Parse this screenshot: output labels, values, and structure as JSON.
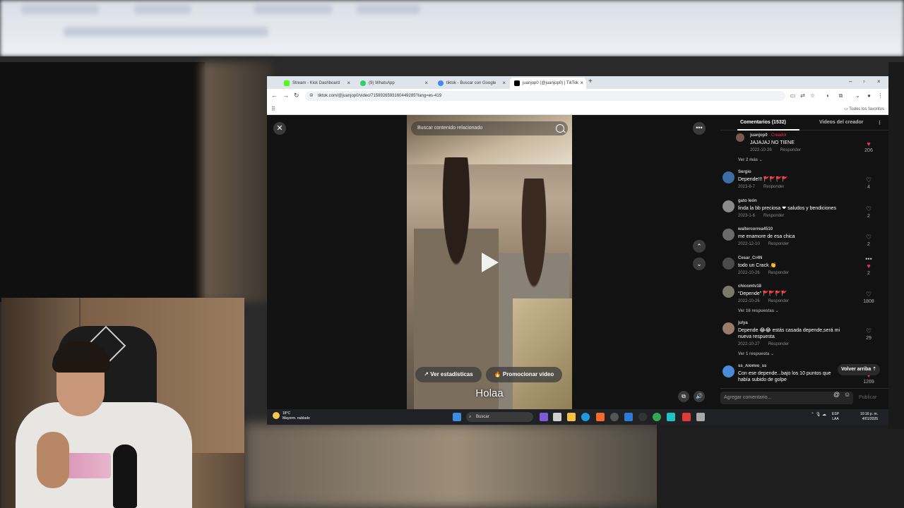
{
  "browser": {
    "tabs": [
      {
        "title": "Stream - Kick Dashboard",
        "color": "#53fc18"
      },
      {
        "title": "(9) WhatsApp",
        "color": "#25d366"
      },
      {
        "title": "tiktok - Buscar con Google",
        "color": "#4285f4"
      },
      {
        "title": "juanjop0 (@juanjop0) | TikTok",
        "color": "#000000"
      }
    ],
    "url": "tiktok.com/@juanjop0/video/7158926593160449285?lang=es-419",
    "bookmarks_label": "Todos los favoritos"
  },
  "video": {
    "search_placeholder": "Buscar contenido relacionado",
    "stats_button": "Ver estadísticas",
    "promote_button": "Promocionar video",
    "caption": "Holaa"
  },
  "comments": {
    "tab_comments": "Comentarios (1532)",
    "tab_creator_videos": "Videos del creador",
    "items": [
      {
        "user": "juanjop0",
        "creator_tag": " · Creador",
        "text": "JAJAJAJ NO TIENE",
        "date": "2022-10-26",
        "reply": "Responder",
        "likes": "206",
        "liked": true,
        "more": "Ver 2 más"
      },
      {
        "user": "Sergio",
        "text": "Depende!!! 🚩🚩🚩🚩",
        "date": "2023-6-7",
        "reply": "Responder",
        "likes": "4",
        "liked": false
      },
      {
        "user": "gato león",
        "text": "linda la bb preciosa ❤ saludos y bendiciones",
        "date": "2023-1-6",
        "reply": "Responder",
        "likes": "2",
        "liked": false
      },
      {
        "user": "waltercorrea4510",
        "text": "me enamore de esa chica",
        "date": "2022-12-10",
        "reply": "Responder",
        "likes": "2",
        "liked": false
      },
      {
        "user": "Cesar_Cr4N",
        "text": "todo un Crack 👏",
        "date": "2022-10-26",
        "reply": "Responder",
        "likes": "2",
        "liked": true
      },
      {
        "user": "chicomtv18",
        "text": "“Depende” 🚩🚩🚩🚩",
        "date": "2022-10-26",
        "reply": "Responder",
        "likes": "1808",
        "liked": false,
        "more": "Ver 16 respuestas"
      },
      {
        "user": "julya",
        "text": "Depende 😂😂 estás casada depende,será mi nueva respuesta",
        "date": "2022-10-27",
        "reply": "Responder",
        "likes": "29",
        "liked": false,
        "more": "Ver 1 respuesta"
      },
      {
        "user": "ss_Alomio_ss",
        "text": "Con ese depende...bajo los 10 puntos que había subido de golpe",
        "date": "",
        "reply": "",
        "likes": "1269",
        "liked": true
      }
    ],
    "scroll_top": "Volver arriba",
    "add_placeholder": "Agregar comentario...",
    "publish": "Publicar"
  },
  "taskbar": {
    "temp": "18°C",
    "weather": "Mayorm. nublado",
    "search": "Buscar",
    "lang1": "ESP",
    "lang2": "LAA",
    "time": "10:16 p. m.",
    "date": "4/01/2026"
  },
  "colors": {
    "accent": "#fe2c55",
    "panel_bg": "#121212"
  }
}
